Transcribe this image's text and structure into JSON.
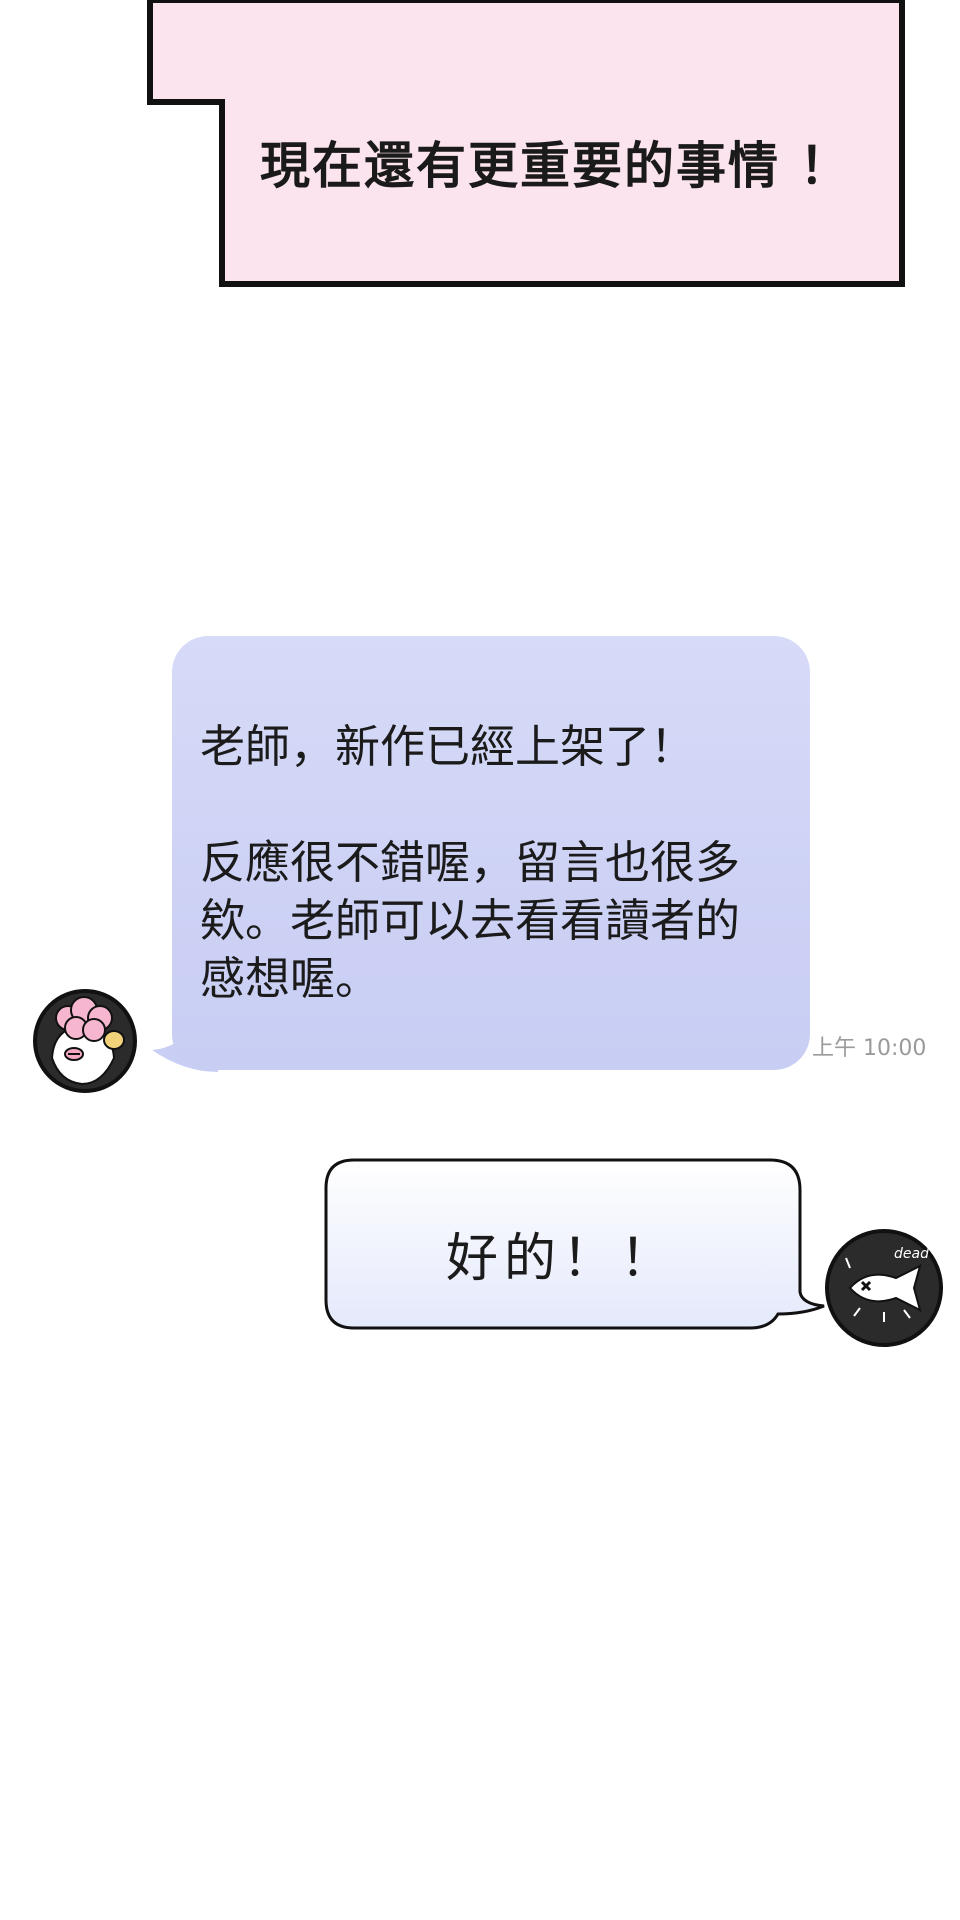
{
  "narration": {
    "text": "現在還有更重要的事情 ！"
  },
  "chat": {
    "incoming": {
      "avatar": "sheep-avatar-icon",
      "lines": [
        "老師，新作已經上架了！",
        "反應很不錯喔，留言也很多",
        "欸。老師可以去看看讀者的",
        "感想喔。"
      ],
      "timestamp": "上午 10:00",
      "bubble_color": "#cdd2f5"
    },
    "outgoing": {
      "avatar": "dead-fish-avatar-icon",
      "avatar_label": "dead",
      "text": "好的！！",
      "bubble_color": "#eef1fd"
    }
  },
  "colors": {
    "narration_fill": "#fce4ef",
    "outline": "#111111"
  }
}
